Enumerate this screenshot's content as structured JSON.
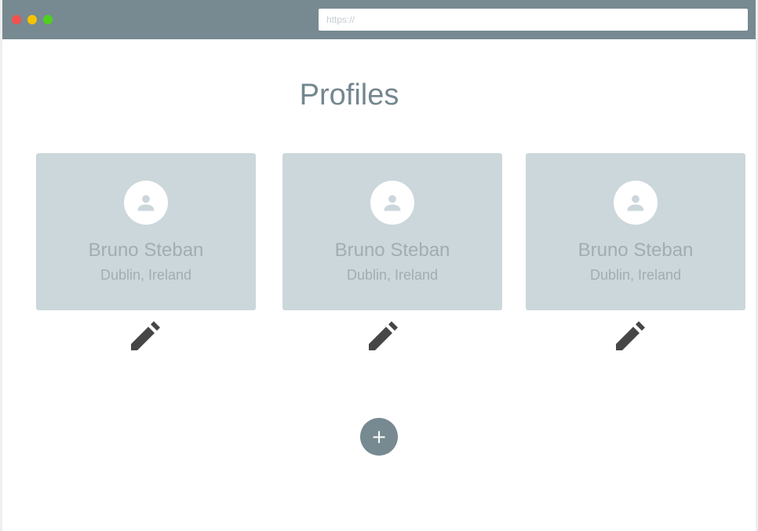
{
  "browser": {
    "url_placeholder": "https://"
  },
  "page": {
    "title": "Profiles"
  },
  "profiles": [
    {
      "name": "Bruno Steban",
      "location": "Dublin, Ireland",
      "avatar_icon": "person-icon",
      "edit_icon": "pencil-icon"
    },
    {
      "name": "Bruno Steban",
      "location": "Dublin, Ireland",
      "avatar_icon": "person-icon",
      "edit_icon": "pencil-icon"
    },
    {
      "name": "Bruno Steban",
      "location": "Dublin, Ireland",
      "avatar_icon": "person-icon",
      "edit_icon": "pencil-icon"
    }
  ],
  "actions": {
    "add_label": "+",
    "add_icon": "plus-icon"
  },
  "colors": {
    "titlebar": "#778a91",
    "card": "#ccd7db",
    "text_muted": "#a1adb3",
    "title": "#74878f",
    "icon_dark": "#464646",
    "close": "#f1524f",
    "minimize": "#f5c400",
    "maximize": "#4fd020"
  }
}
